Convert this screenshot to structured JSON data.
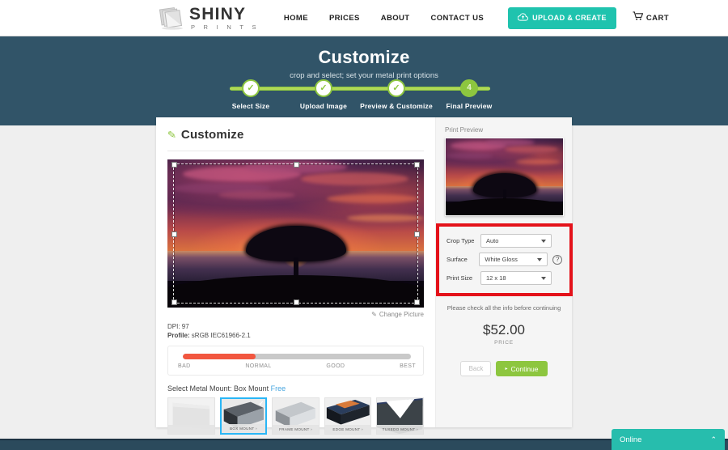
{
  "header": {
    "logo": {
      "primary": "SHINY",
      "secondary": "P R I N T S",
      "icon": "stacked-sheets-icon"
    },
    "nav": [
      {
        "label": "HOME"
      },
      {
        "label": "PRICES"
      },
      {
        "label": "ABOUT"
      },
      {
        "label": "CONTACT US"
      }
    ],
    "upload_button": {
      "label": "UPLOAD & CREATE",
      "icon": "cloud-upload-icon",
      "color": "#1fc3ae"
    },
    "cart": {
      "label": "CART",
      "icon": "shopping-cart-icon"
    }
  },
  "hero": {
    "title": "Customize",
    "subtitle": "crop and select; set your metal print options",
    "background_color": "#315468",
    "steps": [
      {
        "label": "Select Size",
        "state": "done",
        "marker": "✓"
      },
      {
        "label": "Upload Image",
        "state": "done",
        "marker": "✓"
      },
      {
        "label": "Preview & Customize",
        "state": "done",
        "marker": "✓"
      },
      {
        "label": "Final Preview",
        "state": "current",
        "marker": "4"
      }
    ],
    "accent_color": "#8dc63f"
  },
  "customize": {
    "title": "Customize",
    "title_icon": "pencil-icon",
    "change_picture": {
      "label": "Change Picture",
      "icon": "pencil-icon"
    },
    "dpi": "DPI: 97",
    "profile_label": "Profile:",
    "profile_value": " sRGB IEC61966-2.1",
    "quality": {
      "fill_percent": 32,
      "fill_color": "#f2563f",
      "track_color": "#c9c9c9",
      "labels": [
        "BAD",
        "NORMAL",
        "GOOD",
        "BEST"
      ]
    },
    "mount": {
      "prefix": "Select Metal Mount: ",
      "selected": "Box Mount",
      "price": "Free",
      "options": [
        {
          "label": "",
          "selected": false
        },
        {
          "label": "BOX MOUNT  ›",
          "selected": true
        },
        {
          "label": "FRAME MOUNT  ›",
          "selected": false
        },
        {
          "label": "EDGE MOUNT  ›",
          "selected": false
        },
        {
          "label": "TUXEDO MOUNT  ›",
          "selected": false
        }
      ],
      "selected_border_color": "#29b6f6"
    }
  },
  "sidebar": {
    "preview_label": "Print Preview",
    "highlight_color": "#e4121a",
    "options": [
      {
        "label": "Crop Type",
        "value": "Auto"
      },
      {
        "label": "Surface",
        "value": "White Gloss"
      },
      {
        "label": "Print Size",
        "value": "12 x 18"
      }
    ],
    "help_icon": "question-mark-icon",
    "notice": "Please check all the info before continuing",
    "price": "$52.00",
    "price_caption": "PRICE",
    "back_button": "Back",
    "continue_button": "Continue",
    "continue_color": "#8dc63f"
  },
  "chat": {
    "label": "Online",
    "caret": "⌃"
  }
}
